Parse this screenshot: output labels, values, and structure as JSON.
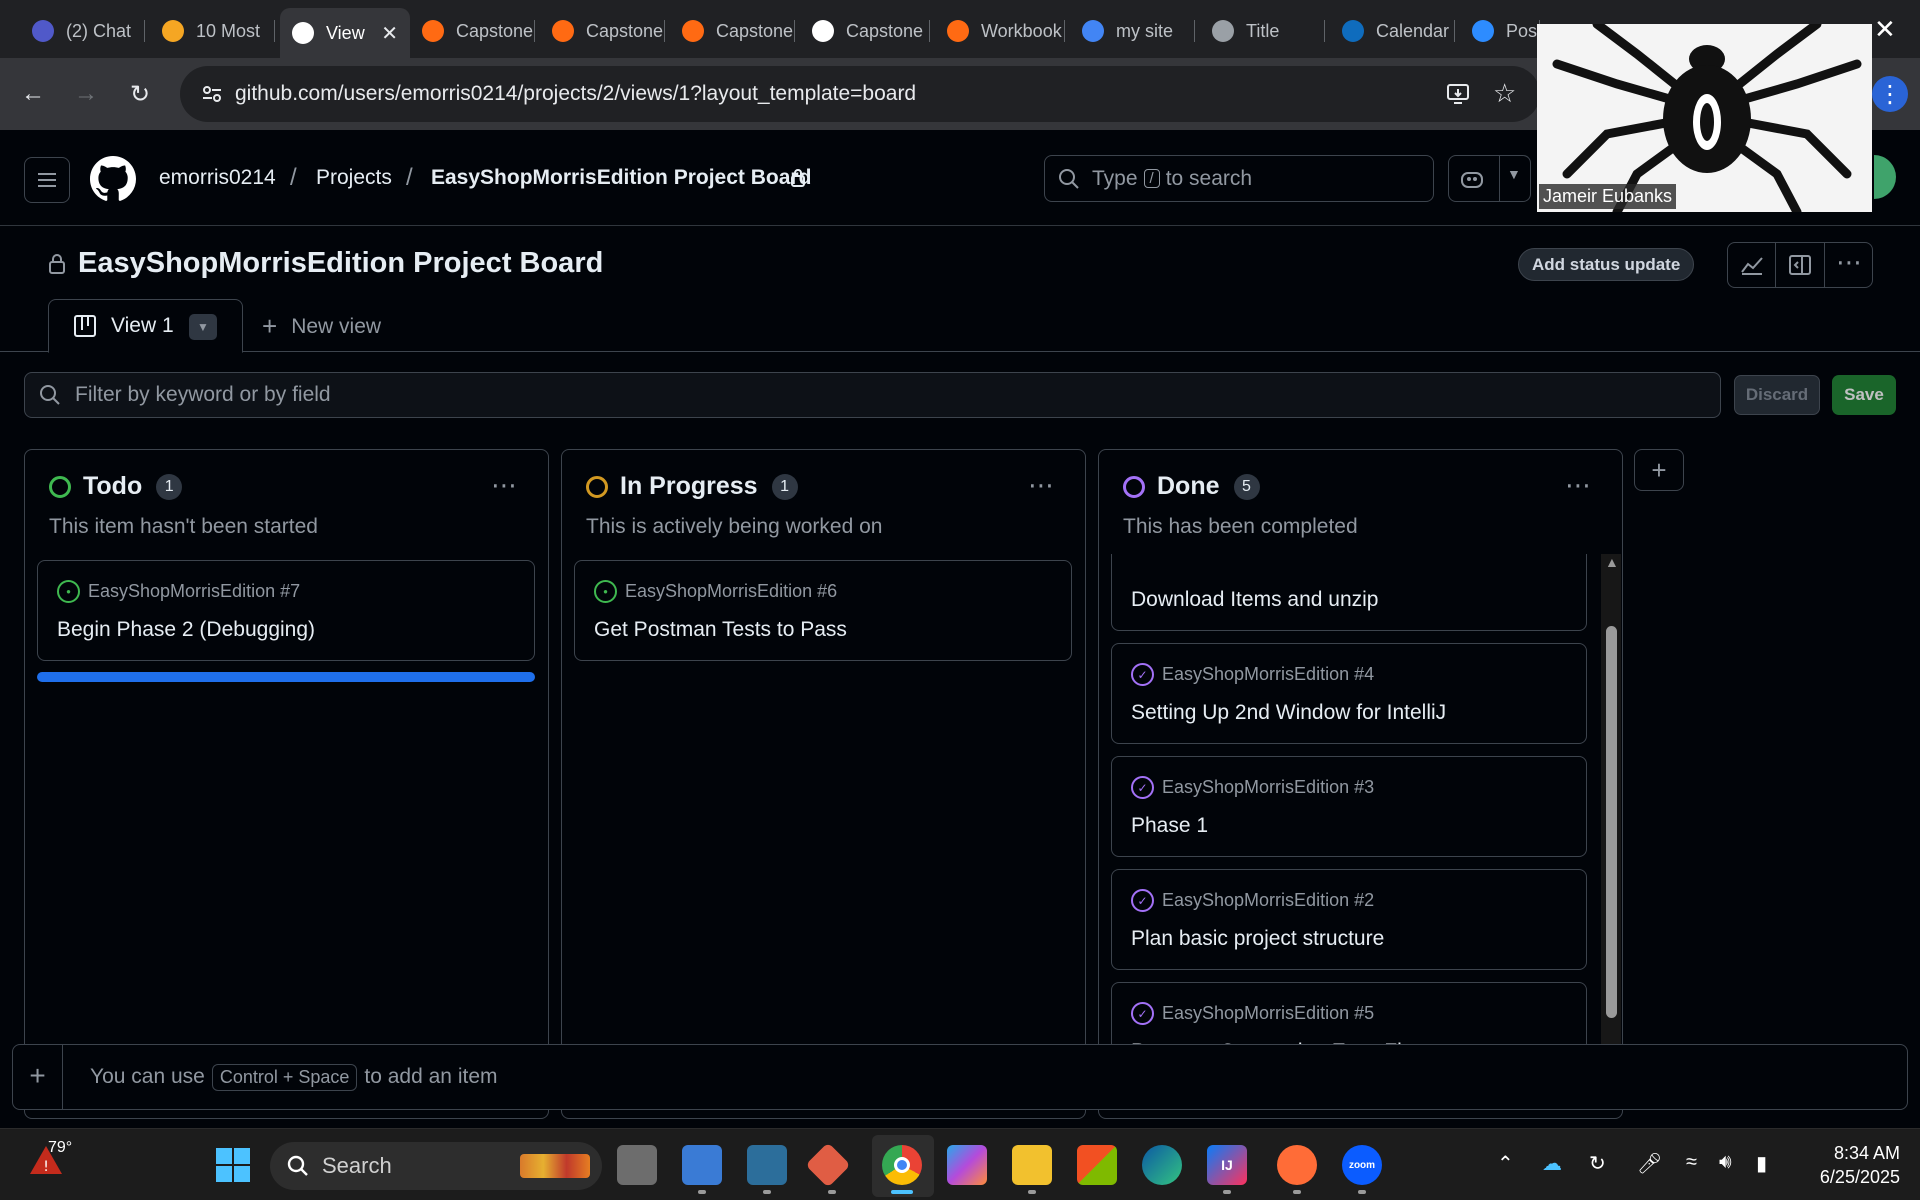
{
  "browser": {
    "tabs": [
      {
        "label": "(2) Chat",
        "icon": "teams-icon",
        "color": "#5059c9"
      },
      {
        "label": "10 Most",
        "icon": "s-logo-icon",
        "color": "#f5a623"
      },
      {
        "label": "View",
        "icon": "github-icon",
        "color": "#ffffff",
        "active": true
      },
      {
        "label": "Capstone",
        "icon": "claude-icon",
        "color": "#ff6a13"
      },
      {
        "label": "Capstone",
        "icon": "claude-icon",
        "color": "#ff6a13"
      },
      {
        "label": "Capstone",
        "icon": "claude-icon",
        "color": "#ff6a13"
      },
      {
        "label": "Capstone",
        "icon": "openai-icon",
        "color": "#ffffff"
      },
      {
        "label": "Workbook",
        "icon": "claude-icon",
        "color": "#ff6a13"
      },
      {
        "label": "my site",
        "icon": "google-icon",
        "color": "#4285f4"
      },
      {
        "label": "Title",
        "icon": "globe-icon",
        "color": "#9aa0a6"
      },
      {
        "label": "Calendar",
        "icon": "outlook-icon",
        "color": "#0f6cbd"
      },
      {
        "label": "Pos",
        "icon": "zoom-icon",
        "color": "#2d8cff"
      }
    ],
    "url": "github.com/users/emorris0214/projects/2/views/1?layout_template=board"
  },
  "header": {
    "owner": "emorris0214",
    "projects_label": "Projects",
    "project_name": "EasyShopMorrisEdition Project Board",
    "search_prefix": "Type",
    "search_key": "/",
    "search_suffix": "to search"
  },
  "project": {
    "title": "EasyShopMorrisEdition Project Board",
    "status_button": "Add status update"
  },
  "views": {
    "active_tab": "View 1",
    "new_view": "New view"
  },
  "filter": {
    "placeholder": "Filter by keyword or by field",
    "discard": "Discard",
    "save": "Save"
  },
  "columns": [
    {
      "name": "Todo",
      "count": "1",
      "description": "This item hasn't been started",
      "color": "#3fb950",
      "cards": [
        {
          "repo": "EasyShopMorrisEdition #7",
          "title": "Begin Phase 2 (Debugging)",
          "state": "open"
        }
      ]
    },
    {
      "name": "In Progress",
      "count": "1",
      "description": "This is actively being worked on",
      "color": "#d29922",
      "cards": [
        {
          "repo": "EasyShopMorrisEdition #6",
          "title": "Get Postman Tests to Pass",
          "state": "open"
        }
      ]
    },
    {
      "name": "Done",
      "count": "5",
      "description": "This has been completed",
      "color": "#a371f7",
      "cards": [
        {
          "repo": "",
          "title": "Download Items and unzip",
          "state": "closed"
        },
        {
          "repo": "EasyShopMorrisEdition #4",
          "title": "Setting Up 2nd Window for IntelliJ",
          "state": "closed"
        },
        {
          "repo": "EasyShopMorrisEdition #3",
          "title": "Phase 1",
          "state": "closed"
        },
        {
          "repo": "EasyShopMorrisEdition #2",
          "title": "Plan basic project structure",
          "state": "closed"
        },
        {
          "repo": "EasyShopMorrisEdition #5",
          "title": "Postman Connection Error Fix",
          "state": "closed"
        }
      ]
    }
  ],
  "add_item": {
    "prefix": "You can use",
    "shortcut": "Control + Space",
    "suffix": "to add an item"
  },
  "video_overlay": {
    "participant": "Jameir Eubanks"
  },
  "taskbar": {
    "weather": "79°",
    "search_label": "Search",
    "time": "8:34 AM",
    "date": "6/25/2025"
  }
}
